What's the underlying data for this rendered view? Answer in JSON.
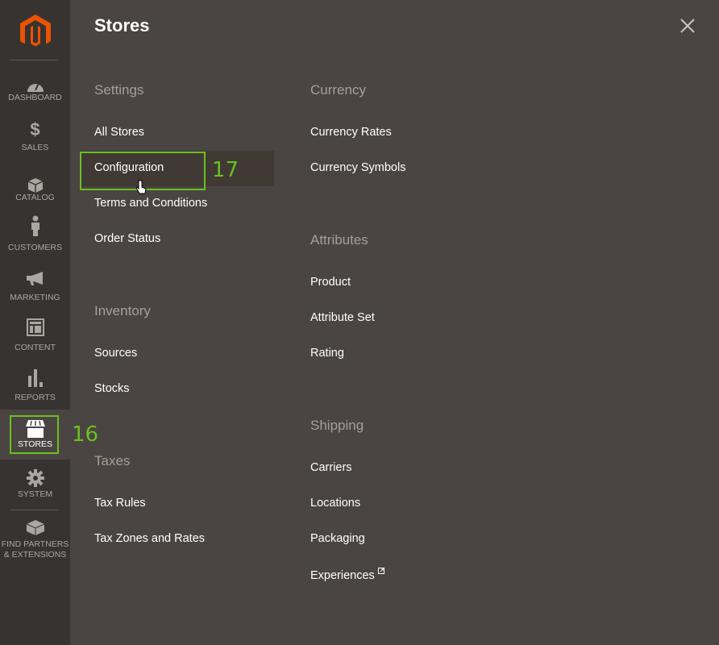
{
  "sidebar": {
    "items": [
      {
        "label": "DASHBOARD",
        "icon": "dashboard-icon"
      },
      {
        "label": "SALES",
        "icon": "dollar-icon"
      },
      {
        "label": "CATALOG",
        "icon": "box-icon"
      },
      {
        "label": "CUSTOMERS",
        "icon": "person-icon"
      },
      {
        "label": "MARKETING",
        "icon": "megaphone-icon"
      },
      {
        "label": "CONTENT",
        "icon": "layout-icon"
      },
      {
        "label": "REPORTS",
        "icon": "bar-chart-icon"
      },
      {
        "label": "STORES",
        "icon": "store-icon",
        "active": true
      },
      {
        "label": "SYSTEM",
        "icon": "gear-icon"
      }
    ],
    "extensions_label_1": "FIND PARTNERS",
    "extensions_label_2": "& EXTENSIONS"
  },
  "annotations": {
    "stores": "16",
    "configuration": "17"
  },
  "panel": {
    "title": "Stores",
    "settings": {
      "header": "Settings",
      "items": [
        "All Stores",
        "Configuration",
        "Terms and Conditions",
        "Order Status"
      ]
    },
    "inventory": {
      "header": "Inventory",
      "items": [
        "Sources",
        "Stocks"
      ]
    },
    "taxes": {
      "header": "Taxes",
      "items": [
        "Tax Rules",
        "Tax Zones and Rates"
      ]
    },
    "currency": {
      "header": "Currency",
      "items": [
        "Currency Rates",
        "Currency Symbols"
      ]
    },
    "attributes": {
      "header": "Attributes",
      "items": [
        "Product",
        "Attribute Set",
        "Rating"
      ]
    },
    "shipping": {
      "header": "Shipping",
      "items": [
        "Carriers",
        "Locations",
        "Packaging",
        "Experiences"
      ]
    }
  },
  "colors": {
    "accent": "#eb5202",
    "highlight": "#6ac01f",
    "sidebar": "#373330",
    "panel": "#4a4542"
  }
}
